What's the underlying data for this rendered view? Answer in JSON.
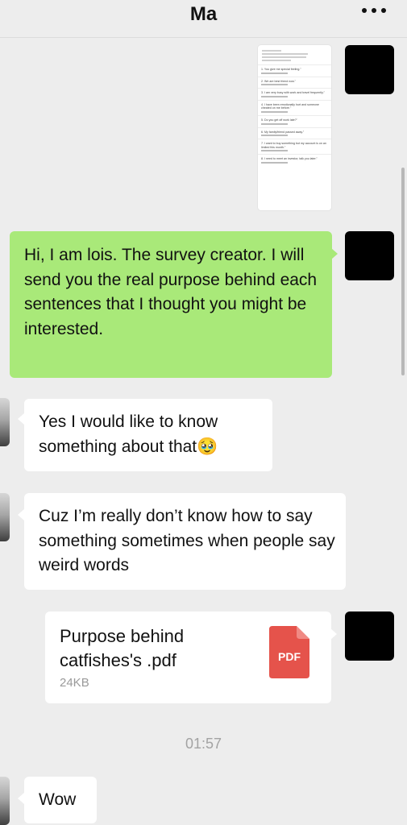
{
  "header": {
    "title": "Ma",
    "more_icon": "more-horizontal-icon"
  },
  "attachment_thumbnail": {
    "questions": [
      "1. You give me special feeling.\"",
      "2. We are best friend now.\"",
      "3. I am very busy with work and travel frequently.\"",
      "4. I have been emotionally hurt and someone cheated on me before.\"",
      "5. Do you get off work late?\"",
      "6. My family/friend passed away.\"",
      "7. I want to buy something but my account is on an limited this month.\"",
      "8. I need to meet an investor, talk you later.\""
    ]
  },
  "messages": [
    {
      "side": "right",
      "text": "Hi,  I am lois. The survey creator. I will send you the real purpose behind each sentences that I thought you might be interested."
    },
    {
      "side": "left",
      "text": "Yes I would like to know something about that🥹"
    },
    {
      "side": "left",
      "text": "Cuz I’m really don’t know how to  say something sometimes when  people say weird words"
    },
    {
      "side": "left",
      "text": "Wow"
    }
  ],
  "file": {
    "name": "Purpose behind catfishes's .pdf",
    "size": "24KB",
    "icon_label": "PDF",
    "icon_color": "#e5534b"
  },
  "timestamp": "01:57",
  "colors": {
    "sent_bubble": "#a9e979",
    "received_bubble": "#ffffff",
    "background": "#ededed"
  }
}
